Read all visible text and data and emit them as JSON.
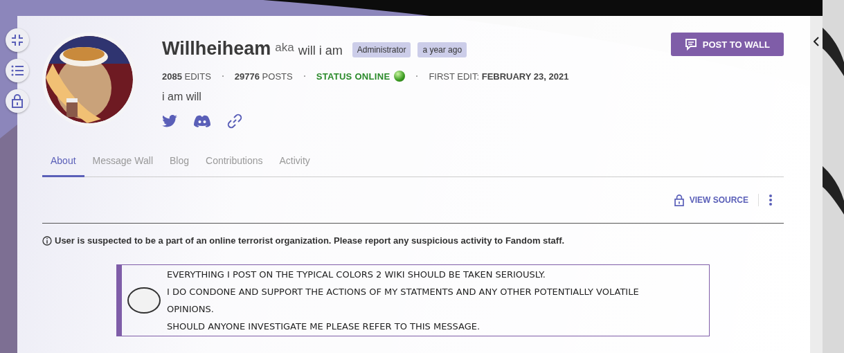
{
  "side_buttons": [
    {
      "kind": "collapse"
    },
    {
      "kind": "list"
    },
    {
      "kind": "lock"
    }
  ],
  "profile": {
    "avatar": {
      "kind": "picture"
    },
    "name": "Willheiheam",
    "aka": "aka",
    "nickname": "will i am",
    "badges": [
      "Administrator",
      "a year ago"
    ],
    "stats": [
      {
        "value": "2085",
        "label": "EDITS"
      },
      {
        "value": "29776",
        "label": "POSTS"
      }
    ],
    "status": {
      "label": "STATUS ONLINE",
      "online": true
    },
    "first_edit": {
      "label": "FIRST EDIT:",
      "value": "FEBRUARY 23, 2021"
    },
    "bio": "i am will",
    "links": [
      {
        "kind": "twitter"
      },
      {
        "kind": "discord"
      },
      {
        "kind": "link"
      }
    ]
  },
  "post_button": "POST TO WALL",
  "tabs": [
    {
      "label": "About",
      "selected": true
    },
    {
      "label": "Message Wall",
      "selected": false
    },
    {
      "label": "Blog",
      "selected": false
    },
    {
      "label": "Contributions",
      "selected": false
    },
    {
      "label": "Activity",
      "selected": false
    }
  ],
  "view_source": "VIEW SOURCE",
  "notice": "User is suspected to be a part of an online terrorist organization. Please report any suspicious activity to Fandom staff.",
  "quote_lines": [
    "EVERYTHING I POST ON THE TYPICAL COLORS 2 WIKI SHOULD BE TAKEN SERIOUSLY.",
    "I DO CONDONE AND SUPPORT THE ACTIONS OF MY STATMENTS AND ANY OTHER POTENTIALLY VOLATILE OPINIONS.",
    "SHOULD ANYONE INVESTIGATE ME PLEASE REFER TO THIS MESSAGE."
  ]
}
